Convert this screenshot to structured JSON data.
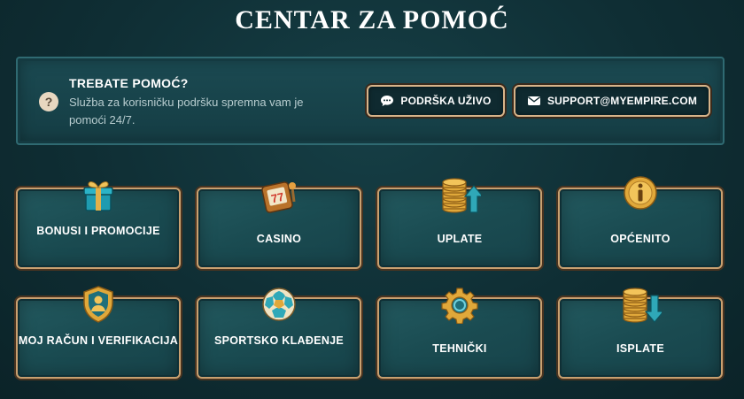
{
  "page_title": "CENTAR ZA POMOĆ",
  "help": {
    "icon": "question-icon",
    "title": "TREBATE POMOĆ?",
    "description": "Služba za korisničku podršku spremna vam je pomoći 24/7.",
    "live_button": "PODRŠKA UŽIVO",
    "email_button": "SUPPORT@MYEMPIRE.COM"
  },
  "categories": [
    {
      "label": "BONUSI I PROMOCIJE",
      "icon": "gift-icon"
    },
    {
      "label": "CASINO",
      "icon": "slot-machine-icon"
    },
    {
      "label": "UPLATE",
      "icon": "coins-deposit-icon"
    },
    {
      "label": "OPĆENITO",
      "icon": "info-icon"
    },
    {
      "label": "MOJ RAČUN I VERIFIKACIJA",
      "icon": "account-shield-icon"
    },
    {
      "label": "SPORTSKO KLAĐENJE",
      "icon": "soccer-ball-icon"
    },
    {
      "label": "TEHNIČKI",
      "icon": "gear-icon"
    },
    {
      "label": "ISPLATE",
      "icon": "coins-withdraw-icon"
    }
  ],
  "colors": {
    "background": "#0f2e34",
    "card_border": "#c9a070",
    "button_border": "#d7b48a"
  }
}
